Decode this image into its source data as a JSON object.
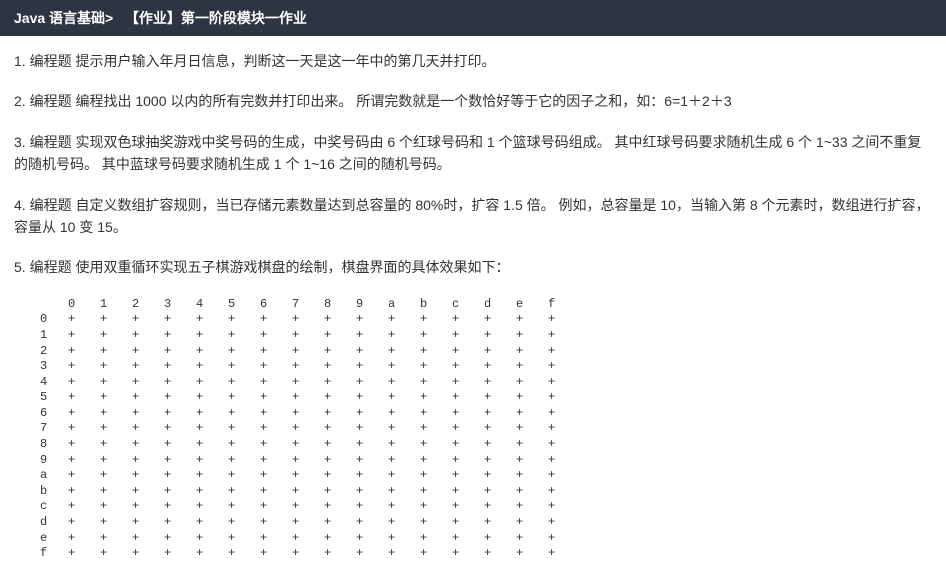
{
  "header": {
    "breadcrumb_part1": "Java 语言基础>",
    "breadcrumb_part2": "【作业】第一阶段模块一作业"
  },
  "problems": [
    {
      "label": "1. 编程题",
      "text": "提示用户输入年月日信息，判断这一天是这一年中的第几天并打印。"
    },
    {
      "label": "2. 编程题",
      "text": "编程找出 1000 以内的所有完数并打印出来。 所谓完数就是一个数恰好等于它的因子之和，如：6=1＋2＋3"
    },
    {
      "label": "3. 编程题",
      "text": "实现双色球抽奖游戏中奖号码的生成，中奖号码由 6 个红球号码和 1 个篮球号码组成。 其中红球号码要求随机生成 6 个 1~33 之间不重复的随机号码。 其中蓝球号码要求随机生成 1 个 1~16 之间的随机号码。"
    },
    {
      "label": "4. 编程题",
      "text": "自定义数组扩容规则，当已存储元素数量达到总容量的 80%时，扩容 1.5 倍。 例如，总容量是 10，当输入第 8 个元素时，数组进行扩容，容量从 10 变 15。"
    },
    {
      "label": "5. 编程题",
      "text": "使用双重循环实现五子棋游戏棋盘的绘制，棋盘界面的具体效果如下："
    }
  ],
  "board": {
    "top_labels": [
      "",
      "0",
      "1",
      "2",
      "3",
      "4",
      "5",
      "6",
      "7",
      "8",
      "9",
      "a",
      "b",
      "c",
      "d",
      "e",
      "f"
    ],
    "row_labels": [
      "0",
      "1",
      "2",
      "3",
      "4",
      "5",
      "6",
      "7",
      "8",
      "9",
      "a",
      "b",
      "c",
      "d",
      "e",
      "f"
    ],
    "cell_symbol": "+",
    "cols": 16
  }
}
